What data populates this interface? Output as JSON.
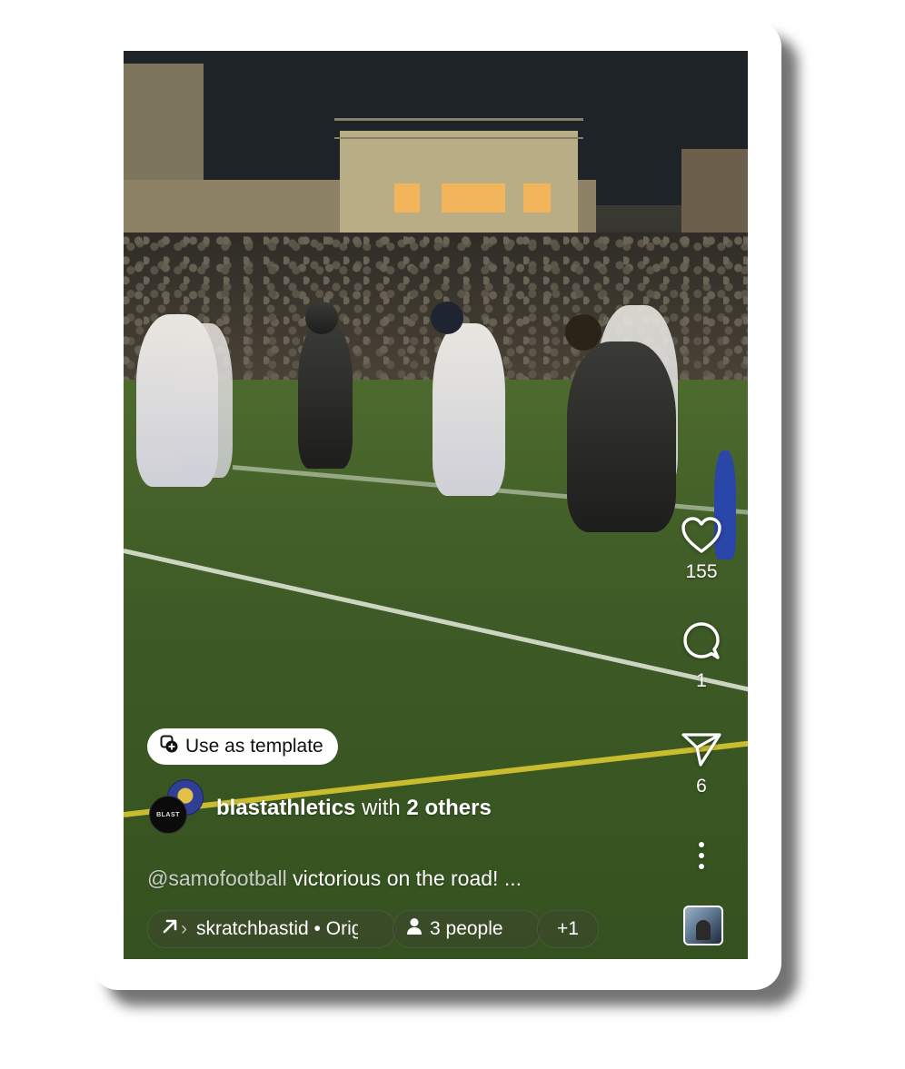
{
  "post": {
    "template_button_label": "Use as template",
    "author": "blastathletics",
    "with_text": "with",
    "collaborators": "2 others",
    "avatar_text": "BLAST",
    "caption_mention": "@samofootball",
    "caption_text": " victorious on the road! ...",
    "audio_label": "skratchbastid • Original audio",
    "people_label": "3 people",
    "more_label": "+1"
  },
  "actions": {
    "likes": "155",
    "comments": "1",
    "shares": "6"
  },
  "icons": {
    "like": "heart-icon",
    "comment": "comment-bubble-icon",
    "share": "paper-plane-icon",
    "more": "more-vertical-icon",
    "template": "template-add-icon",
    "audio": "arrow-up-right-icon",
    "people": "person-icon"
  },
  "colors": {
    "overlay_text": "#ffffff",
    "button_bg": "#ffffff",
    "field_green": "#3e5a26",
    "yellow_line": "#c9bc2e"
  }
}
